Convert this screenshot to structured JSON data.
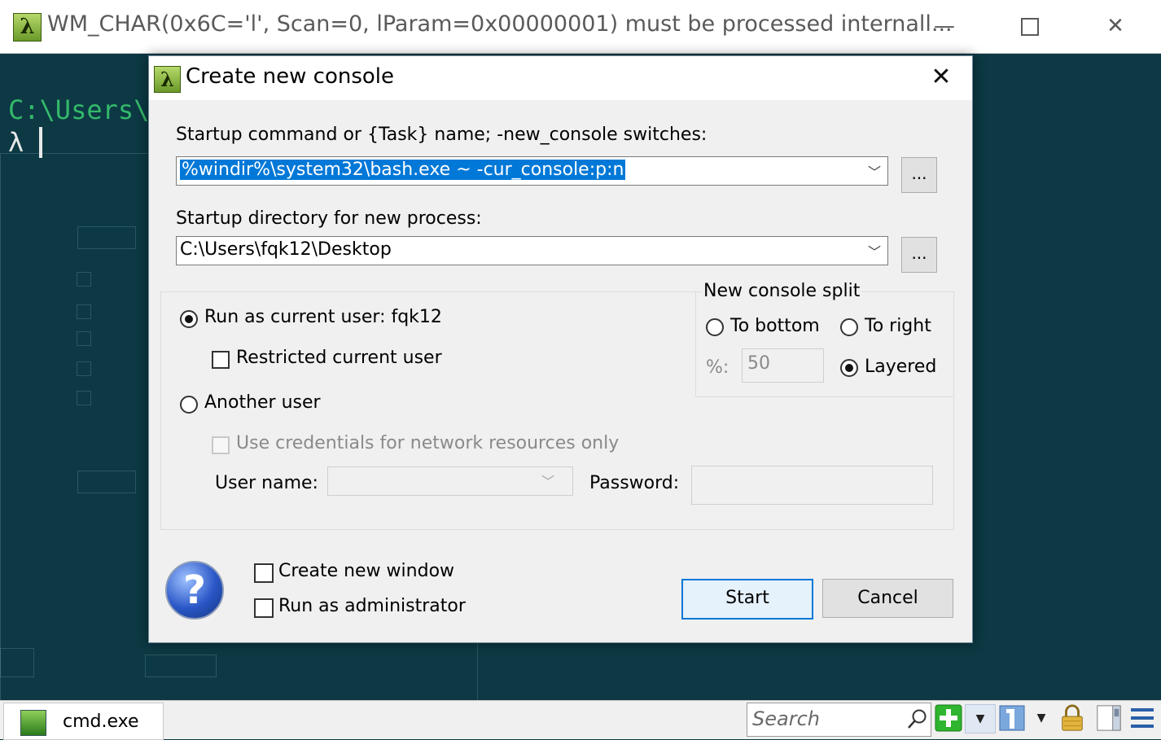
{
  "window": {
    "title": "WM_CHAR(0x6C='l', Scan=0, lParam=0x00000001) must be processed internall...",
    "icon": "lambda-icon",
    "minimize_glyph": "—",
    "close_glyph": "✕"
  },
  "terminal": {
    "path_fragment": "C:\\Users\\",
    "prompt": "λ"
  },
  "dialog": {
    "title": "Create new console",
    "close_glyph": "✕",
    "command_label": "Startup command or {Task} name; -new_console switches:",
    "command_value": "%windir%\\system32\\bash.exe ~ -cur_console:p:n",
    "directory_label": "Startup directory for new process:",
    "directory_value": "C:\\Users\\fqk12\\Desktop",
    "browse_label": "...",
    "run_current_user_label": "Run as current user: fqk12",
    "run_current_user_selected": true,
    "restricted_label": "Restricted current user",
    "another_user_label": "Another user",
    "network_credentials_label": "Use credentials for network resources only",
    "user_name_label": "User name:",
    "password_label": "Password:",
    "split": {
      "group_label": "New console split",
      "to_bottom_label": "To bottom",
      "to_right_label": "To right",
      "percent_label": "%:",
      "percent_value": "50",
      "layered_label": "Layered",
      "selected": "Layered"
    },
    "create_new_window_label": "Create new window",
    "run_as_admin_label": "Run as administrator",
    "help_glyph": "?",
    "start_label": "Start",
    "cancel_label": "Cancel"
  },
  "statusbar": {
    "tab_label": "cmd.exe",
    "search_placeholder": "Search",
    "icons": [
      "search-icon",
      "new-console-icon",
      "dropdown-arrow-icon",
      "window-list-icon",
      "lock-icon",
      "scroll-icon",
      "menu-icon"
    ]
  },
  "colors": {
    "terminal_bg": "#0c3944",
    "terminal_path": "#34b96a",
    "selection": "#0078d7",
    "new_console_green": "#2fb52f"
  }
}
